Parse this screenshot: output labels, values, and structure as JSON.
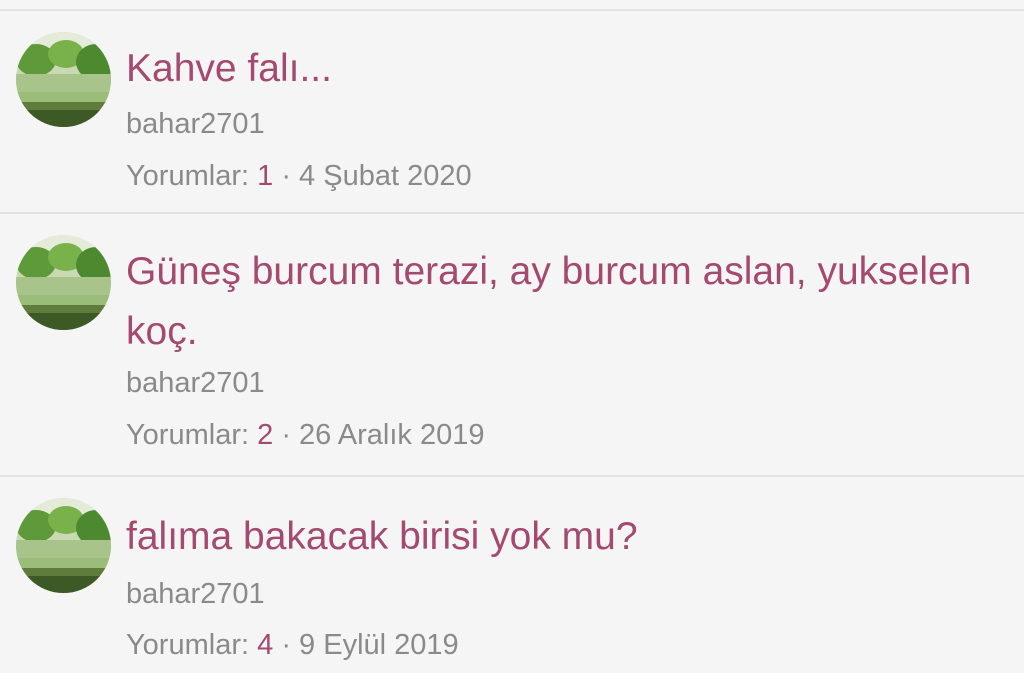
{
  "threads": [
    {
      "title": "Kahve falı...",
      "author": "bahar2701",
      "replies_label": "Yorumlar:",
      "replies_count": "1",
      "separator": "·",
      "date": "4 Şubat 2020",
      "avatar_icon": "user-avatar-landscape"
    },
    {
      "title": "Güneş burcum terazi, ay burcum aslan, yukselen koç.",
      "author": "bahar2701",
      "replies_label": "Yorumlar:",
      "replies_count": "2",
      "separator": "·",
      "date": "26 Aralık 2019",
      "avatar_icon": "user-avatar-landscape"
    },
    {
      "title": "falıma bakacak birisi yok mu?",
      "author": "bahar2701",
      "replies_label": "Yorumlar:",
      "replies_count": "4",
      "separator": "·",
      "date": "9 Eylül 2019",
      "avatar_icon": "user-avatar-landscape"
    }
  ],
  "colors": {
    "background": "#f5f5f5",
    "title": "#a44a70",
    "muted": "#8a8a8a",
    "divider": "#e2e2e2"
  }
}
